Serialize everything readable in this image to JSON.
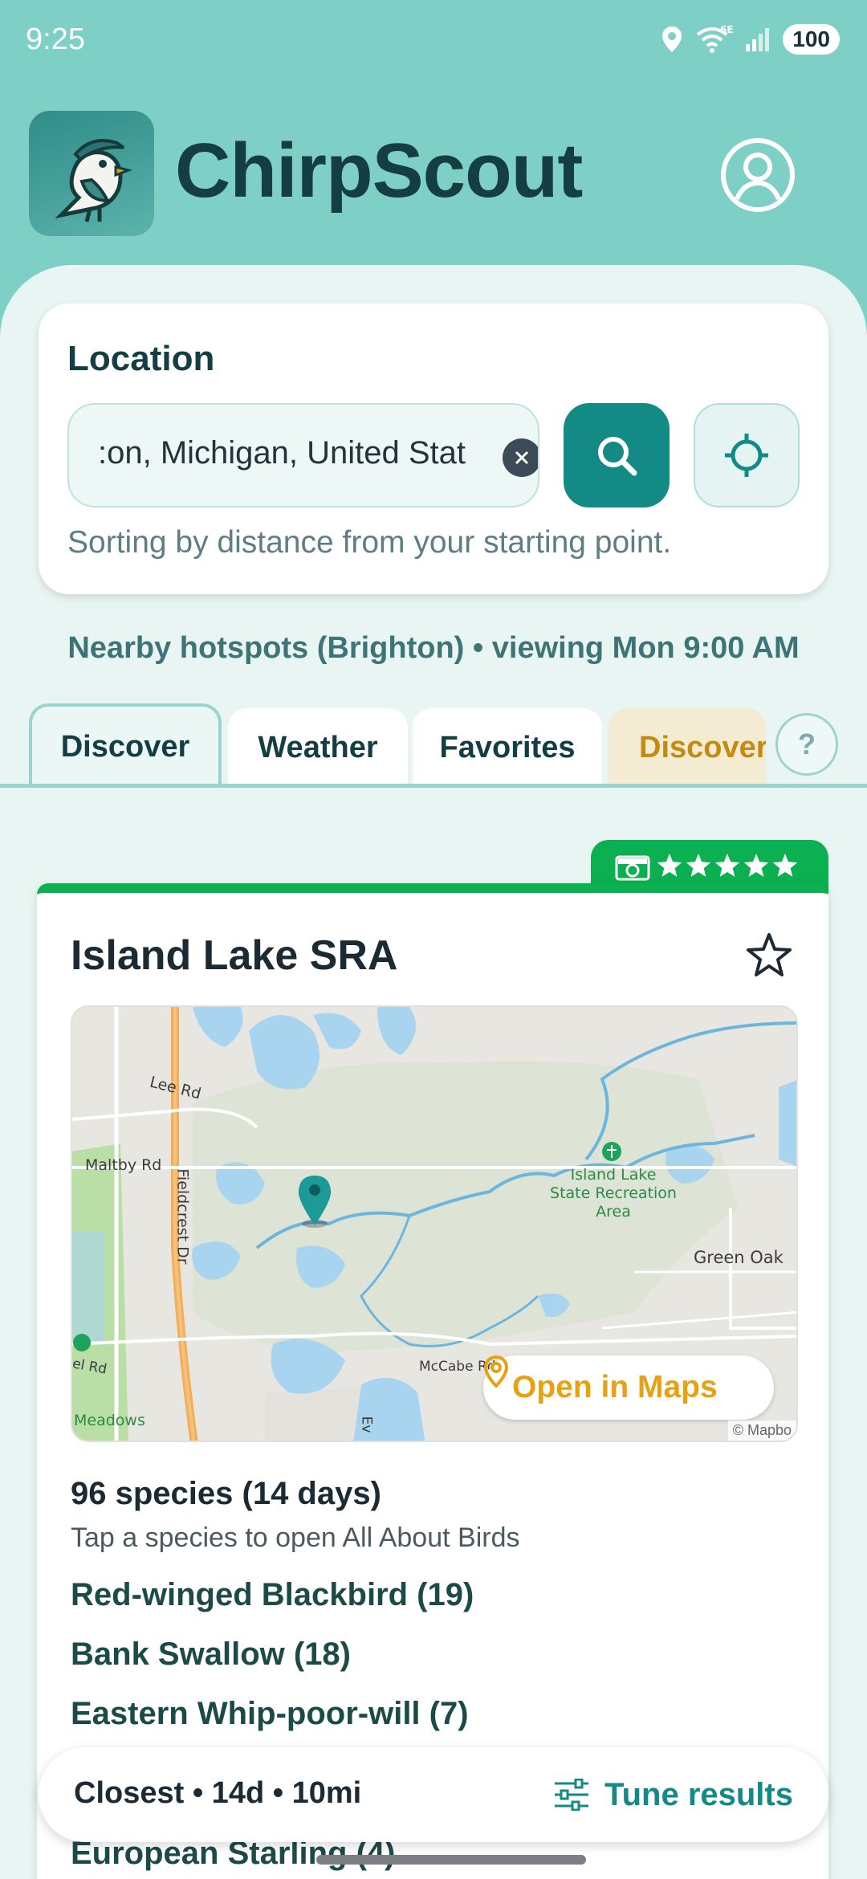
{
  "status_bar": {
    "time": "9:25",
    "battery": "100",
    "network": "6E"
  },
  "header": {
    "title": "ChirpScout"
  },
  "location": {
    "label": "Location",
    "input_value": ":on, Michigan, United Stat",
    "hint": "Sorting by distance from your starting point."
  },
  "nearby": "Nearby hotspots (Brighton) • viewing Mon 9:00 AM",
  "tabs": [
    {
      "label": "Discover",
      "active": true
    },
    {
      "label": "Weather",
      "active": false
    },
    {
      "label": "Favorites",
      "active": false
    },
    {
      "label": "Discover+",
      "active": false
    }
  ],
  "help_label": "?",
  "hotspot": {
    "name": "Island Lake SRA",
    "rating_stars": 5,
    "map_labels": {
      "lee_rd": "Lee Rd",
      "maltby_rd": "Maltby Rd",
      "fieldcrest_dr": "Fieldcrest Dr",
      "park_name": "Island Lake State Recreation Area",
      "green_oak": "Green Oak",
      "mccabe_rd": "McCabe Rd",
      "el_rd": "el Rd",
      "meadows": "Meadows",
      "ev": "Ev",
      "attribution": "© Mapbo"
    },
    "open_maps_label": "Open in Maps",
    "species_count": "96 species (14 days)",
    "species_hint": "Tap a species to open All About Birds",
    "species": [
      "Red-winged Blackbird (19)",
      "Bank Swallow (18)",
      "Eastern Whip-poor-will (7)"
    ],
    "last_species": "European Starling (4)"
  },
  "bottom_bar": {
    "summary": "Closest • 14d • 10mi",
    "tune_label": "Tune results"
  },
  "colors": {
    "accent": "#148a86",
    "header_bg": "#7ed0c6",
    "rating_green": "#0bb050",
    "maps_orange": "#e6a214"
  }
}
